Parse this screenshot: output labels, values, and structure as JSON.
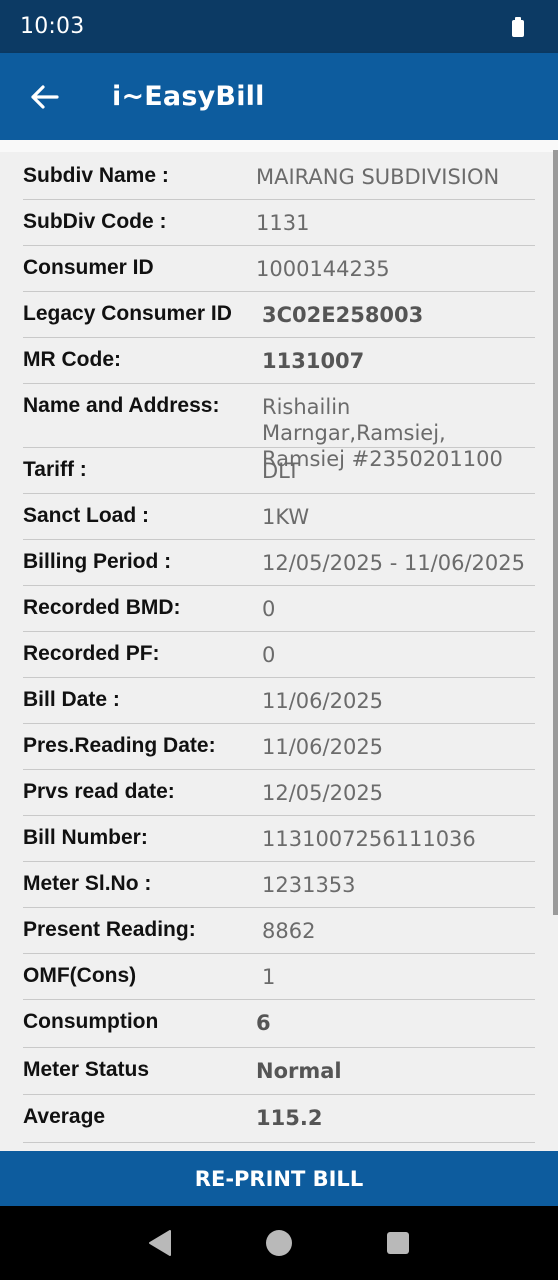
{
  "status_bar": {
    "time": "10:03",
    "battery_icon": "battery-icon"
  },
  "app_bar": {
    "title": "i~EasyBill",
    "back_icon": "arrow-back-icon",
    "color": "#0d5c9e"
  },
  "details": [
    {
      "label": "Subdiv Name :",
      "value": "MAIRANG SUBDIVISION",
      "bold": false
    },
    {
      "label": "SubDiv Code :",
      "value": "1131",
      "bold": false
    },
    {
      "label": "Consumer ID",
      "value": "1000144235",
      "bold": false
    },
    {
      "label": "Legacy Consumer ID",
      "value": "3C02E258003",
      "bold": true
    },
    {
      "label": "MR Code:",
      "value": "1131007",
      "bold": true
    },
    {
      "label": "Name and Address:",
      "value": "Rishailin Marngar,Ramsiej, Ramsiej #2350201100",
      "bold": false
    },
    {
      "label": "Tariff  :",
      "value": "DLT",
      "bold": false
    },
    {
      "label": "Sanct Load  :",
      "value": "1KW",
      "bold": false
    },
    {
      "label": "Billing Period  :",
      "value": "12/05/2025 - 11/06/2025",
      "bold": false
    },
    {
      "label": "Recorded BMD:",
      "value": "0",
      "bold": false
    },
    {
      "label": "Recorded PF:",
      "value": "0",
      "bold": false
    },
    {
      "label": "Bill Date :",
      "value": "11/06/2025",
      "bold": false
    },
    {
      "label": "Pres.Reading Date:",
      "value": "11/06/2025",
      "bold": false
    },
    {
      "label": "Prvs read date:",
      "value": "12/05/2025",
      "bold": false
    },
    {
      "label": "Bill Number:",
      "value": "1131007256111036",
      "bold": false
    },
    {
      "label": "Meter Sl.No  :",
      "value": "1231353",
      "bold": false
    },
    {
      "label": "Present Reading:",
      "value": "8862",
      "bold": false
    },
    {
      "label": "OMF(Cons)",
      "value": "1",
      "bold": false
    },
    {
      "label": "Consumption",
      "value": "6",
      "bold": true
    },
    {
      "label": "Meter Status",
      "value": "Normal",
      "bold": true
    },
    {
      "label": "Average",
      "value": "115.2",
      "bold": true
    }
  ],
  "reprint_button": {
    "label": "RE-PRINT BILL"
  },
  "nav_bar": {
    "back": "nav-back-icon",
    "home": "nav-home-icon",
    "recents": "nav-recents-icon"
  }
}
